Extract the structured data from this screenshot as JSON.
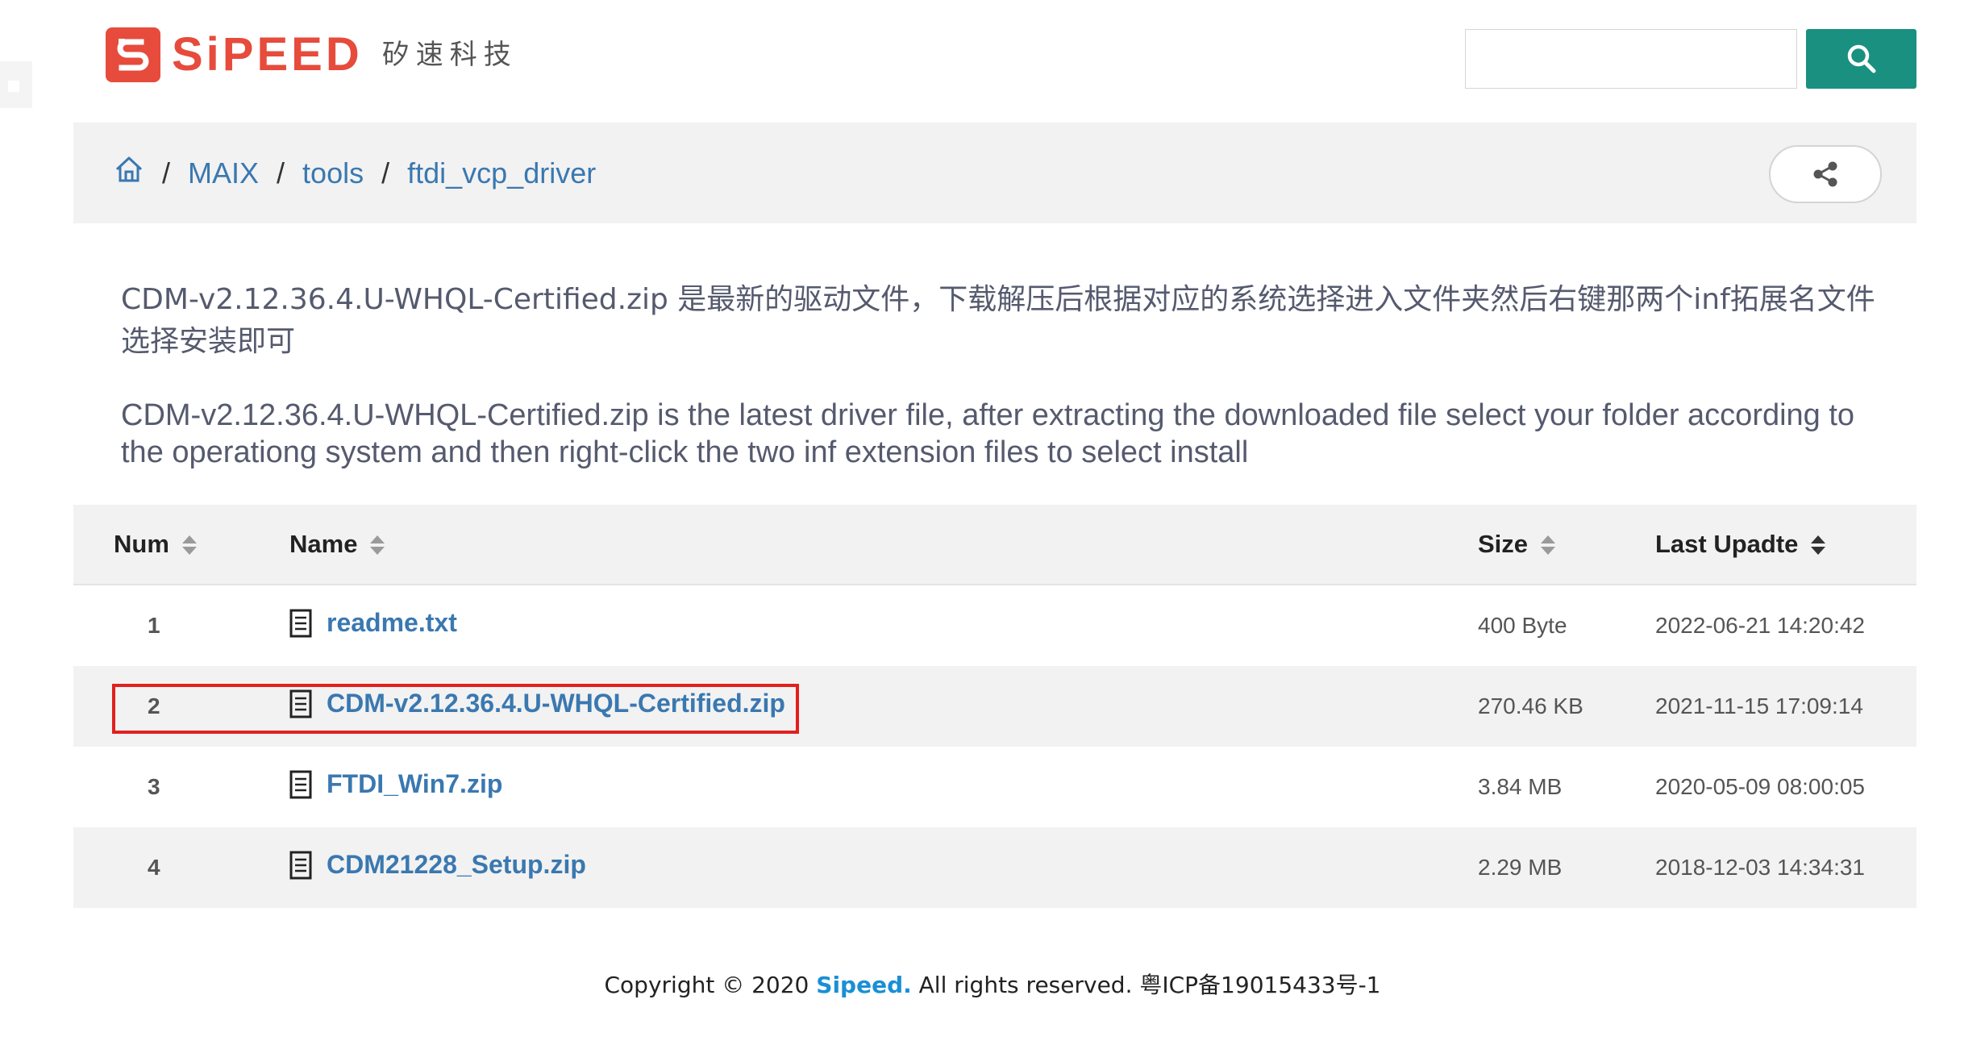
{
  "header": {
    "logo_text": "SiPEED",
    "logo_cn": "矽速科技",
    "search_placeholder": "",
    "search_icon": "search-icon"
  },
  "breadcrumb": {
    "home_icon": "home-icon",
    "separator": "/",
    "items": [
      "MAIX",
      "tools",
      "ftdi_vcp_driver"
    ],
    "share_icon": "share-icon"
  },
  "description": {
    "cn": "CDM-v2.12.36.4.U-WHQL-Certified.zip 是最新的驱动文件，下载解压后根据对应的系统选择进入文件夹然后右键那两个inf拓展名文件选择安装即可",
    "en": "CDM-v2.12.36.4.U-WHQL-Certified.zip is the latest driver file, after extracting the downloaded file select your folder according to the operationg system and then right-click the two inf extension files to select install"
  },
  "table": {
    "columns": [
      "Num",
      "Name",
      "Size",
      "Last Upadte"
    ],
    "sorted_column": "Last Upadte",
    "rows": [
      {
        "num": "1",
        "name": "readme.txt",
        "size": "400 Byte",
        "updated": "2022-06-21 14:20:42"
      },
      {
        "num": "2",
        "name": "CDM-v2.12.36.4.U-WHQL-Certified.zip",
        "size": "270.46 KB",
        "updated": "2021-11-15 17:09:14"
      },
      {
        "num": "3",
        "name": "FTDI_Win7.zip",
        "size": "3.84 MB",
        "updated": "2020-05-09 08:00:05"
      },
      {
        "num": "4",
        "name": "CDM21228_Setup.zip",
        "size": "2.29 MB",
        "updated": "2018-12-03 14:34:31"
      }
    ],
    "highlighted_row": "2"
  },
  "footer": {
    "prefix": "Copyright © 2020",
    "brand": "Sipeed.",
    "suffix": "All rights reserved. 粤ICP备19015433号-1"
  },
  "colors": {
    "brand_red": "#e64b3c",
    "search_green": "#1a9080",
    "link_blue": "#3a78b0",
    "highlight_red": "#e02020"
  }
}
